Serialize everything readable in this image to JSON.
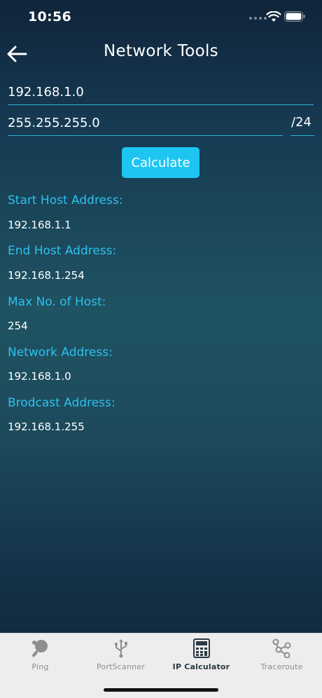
{
  "status": {
    "time": "10:56"
  },
  "header": {
    "title": "Network Tools",
    "back_icon": "arrow-left-icon"
  },
  "form": {
    "ip_value": "192.168.1.0",
    "mask_value": "255.255.255.0",
    "cidr": "/24",
    "calculate_label": "Calculate"
  },
  "results": [
    {
      "label": "Start Host Address:",
      "value": "192.168.1.1"
    },
    {
      "label": "End Host Address:",
      "value": "192.168.1.254"
    },
    {
      "label": "Max No. of Host:",
      "value": "254"
    },
    {
      "label": "Network Address:",
      "value": "192.168.1.0"
    },
    {
      "label": "Brodcast Address:",
      "value": "192.168.1.255"
    }
  ],
  "tabs": [
    {
      "label": "Ping",
      "icon": "ping-pong-icon"
    },
    {
      "label": "PortScanner",
      "icon": "usb-icon"
    },
    {
      "label": "IP Calculator",
      "icon": "calculator-icon"
    },
    {
      "label": "Traceroute",
      "icon": "route-icon"
    }
  ],
  "colors": {
    "accent": "#1ec5f2",
    "label": "#2ec0ee",
    "tab_bar": "#ededed"
  }
}
